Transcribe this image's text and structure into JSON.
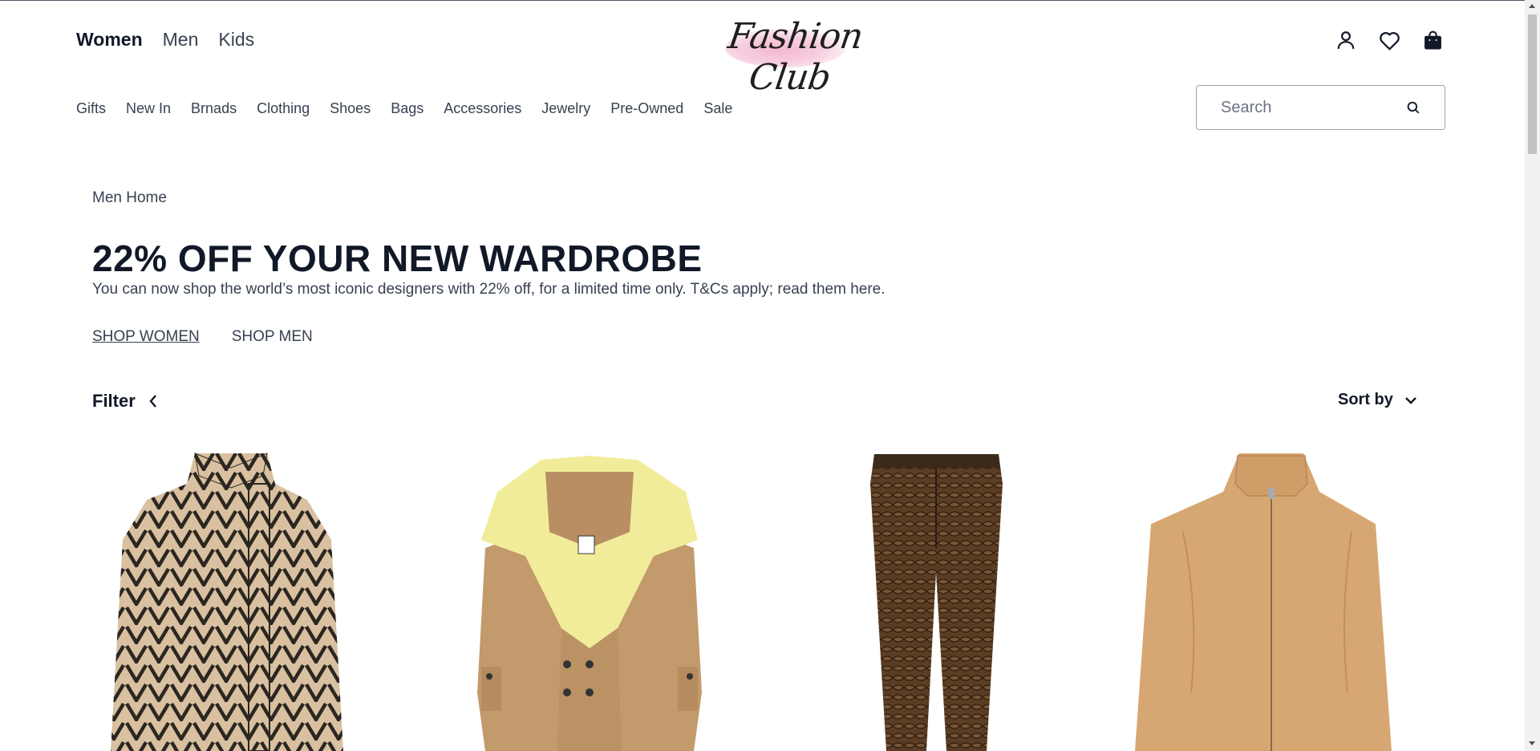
{
  "header": {
    "gender_nav": [
      {
        "label": "Women",
        "active": true
      },
      {
        "label": "Men",
        "active": false
      },
      {
        "label": "Kids",
        "active": false
      }
    ],
    "logo_text": "Fashion Club",
    "icons": [
      "user-icon",
      "heart-icon",
      "shopping-bag-icon"
    ],
    "categories": [
      "Gifts",
      "New In",
      "Brnads",
      "Clothing",
      "Shoes",
      "Bags",
      "Accessories",
      "Jewelry",
      "Pre-Owned",
      "Sale"
    ],
    "search": {
      "placeholder": "Search",
      "value": ""
    }
  },
  "breadcrumb": "Men Home",
  "promo": {
    "title": "22% OFF YOUR NEW WARDROBE",
    "description": "You can now shop the world’s most iconic designers with 22% off, for a limited time only. T&Cs apply; read them here.",
    "links": [
      "SHOP WOMEN",
      "SHOP MEN"
    ]
  },
  "filter_label": "Filter",
  "sort_label": "Sort by",
  "products": [
    {
      "name": "printed-shirt",
      "colors": [
        "#d8c0a0",
        "#2b2620"
      ]
    },
    {
      "name": "camel-coat-yellow-collar",
      "colors": [
        "#c29a6b",
        "#f1ec9a"
      ]
    },
    {
      "name": "snakeskin-trousers",
      "colors": [
        "#5a3d23",
        "#2a1c12"
      ]
    },
    {
      "name": "suede-zip-jacket",
      "colors": [
        "#d7a773",
        "#c08f5c"
      ]
    }
  ],
  "colors": {
    "text": "#111827",
    "muted": "#374151",
    "border": "#9ca3af",
    "logo_pink": "#f3b8cf"
  }
}
